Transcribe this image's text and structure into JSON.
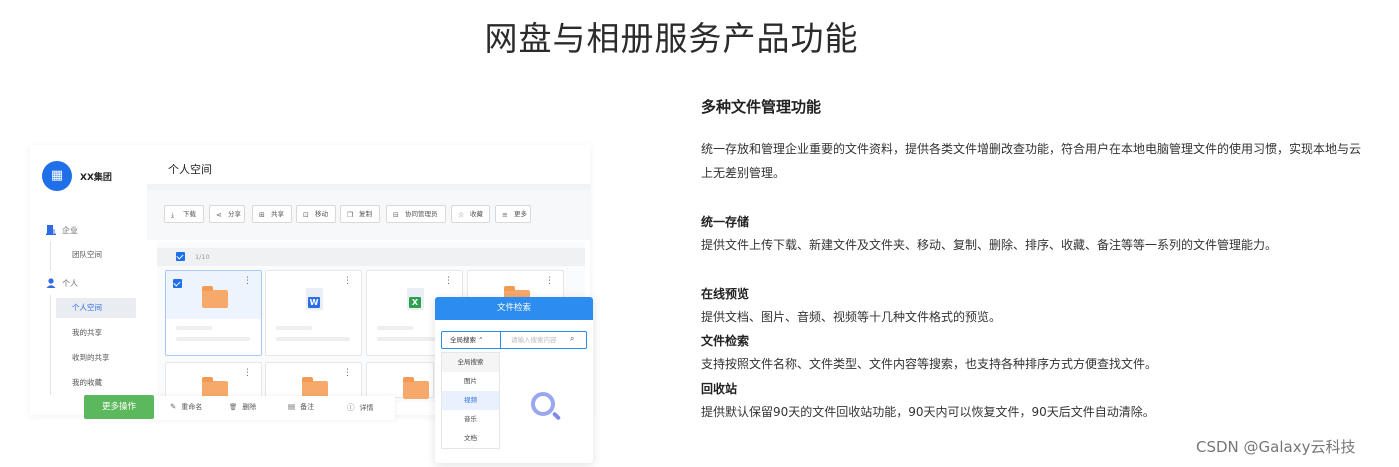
{
  "page_title": "网盘与相册服务产品功能",
  "mockup": {
    "org_logo_text": "▦",
    "org_name": "XX集团",
    "nav": {
      "group_enterprise": "企业",
      "team_space": "团队空间",
      "group_personal": "个人",
      "personal_space": "个人空间",
      "my_shares": "我的共享",
      "received_shares": "收到的共享",
      "my_favorites": "我的收藏"
    },
    "space_title": "个人空间",
    "toolbar": [
      {
        "icon": "download-icon",
        "glyph": "⤓",
        "label": "下载"
      },
      {
        "icon": "share-icon",
        "glyph": "⋖",
        "label": "分享"
      },
      {
        "icon": "share-folder-icon",
        "glyph": "⊞",
        "label": "共享"
      },
      {
        "icon": "move-icon",
        "glyph": "⊡",
        "label": "移动"
      },
      {
        "icon": "copy-icon",
        "glyph": "❐",
        "label": "复制"
      },
      {
        "icon": "collab-icon",
        "glyph": "⊟",
        "label": "协同管理员"
      },
      {
        "icon": "star-icon",
        "glyph": "☆",
        "label": "收藏"
      },
      {
        "icon": "more-icon",
        "glyph": "≡",
        "label": "更多"
      }
    ],
    "selection_count": "1/10",
    "doc_word_letter": "W",
    "doc_excel_letter": "X",
    "card_menu_glyph": "⋮",
    "more_actions_label": "更多操作",
    "bottom_actions": [
      {
        "icon": "rename-icon",
        "glyph": "✎",
        "label": "重命名"
      },
      {
        "icon": "delete-icon",
        "glyph": "🗑",
        "label": "删除"
      },
      {
        "icon": "note-icon",
        "glyph": "▤",
        "label": "备注"
      },
      {
        "icon": "info-icon",
        "glyph": "ⓘ",
        "label": "详情"
      }
    ],
    "search_popup": {
      "title": "文件检索",
      "scope_selected": "全局搜索 ⌃",
      "input_placeholder": "请输入搜索内容",
      "search_glyph": "⌕",
      "options": [
        "全局搜索",
        "图片",
        "视频",
        "音乐",
        "文档"
      ],
      "highlighted_option": "视频"
    }
  },
  "features": {
    "title": "多种文件管理功能",
    "intro": "统一存放和管理企业重要的文件资料，提供各类文件增删改查功能，符合用户在本地电脑管理文件的使用习惯，实现本地与云上无差别管理。",
    "items": [
      {
        "heading": "统一存储",
        "text": "提供文件上传下载、新建文件及文件夹、移动、复制、删除、排序、收藏、备注等等一系列的文件管理能力。"
      },
      {
        "heading": "在线预览",
        "text": "提供文档、图片、音频、视频等十几种文件格式的预览。"
      },
      {
        "heading": "文件检索",
        "text": "支持按照文件名称、文件类型、文件内容等搜索，也支持各种排序方式方便查找文件。"
      },
      {
        "heading": "回收站",
        "text": "提供默认保留90天的文件回收站功能，90天内可以恢复文件，90天后文件自动清除。"
      }
    ]
  },
  "watermark": "CSDN @Galaxy云科技",
  "colors": {
    "accent": "#1f6fe8",
    "popup_header": "#2d8cf0",
    "more_button": "#5cb85c",
    "folder": "#f6a96b"
  }
}
